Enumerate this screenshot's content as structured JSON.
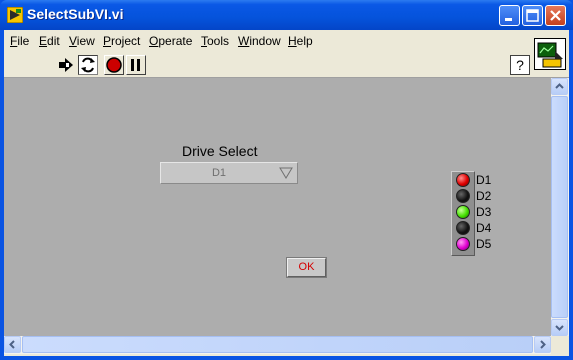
{
  "window": {
    "title": "SelectSubVI.vi",
    "controls": [
      "minimize-icon",
      "maximize-icon",
      "close-icon"
    ]
  },
  "menubar": {
    "items": [
      {
        "label": "File",
        "key": "F",
        "rest": "ile"
      },
      {
        "label": "Edit",
        "key": "E",
        "rest": "dit"
      },
      {
        "label": "View",
        "key": "V",
        "rest": "iew"
      },
      {
        "label": "Project",
        "key": "P",
        "rest": "roject"
      },
      {
        "label": "Operate",
        "key": "O",
        "rest": "perate"
      },
      {
        "label": "Tools",
        "key": "T",
        "rest": "ools"
      },
      {
        "label": "Window",
        "key": "W",
        "rest": "indow"
      },
      {
        "label": "Help",
        "key": "H",
        "rest": "elp"
      }
    ]
  },
  "toolbar": {
    "tools": [
      "run-arrow-icon",
      "run-continuously-icon",
      "abort-icon",
      "pause-icon"
    ],
    "help_label": "?"
  },
  "panel": {
    "drive_select": {
      "label": "Drive Select",
      "value": "D1"
    },
    "ok_button": {
      "label": "OK"
    },
    "leds": [
      {
        "label": "D1",
        "color": "#e00000"
      },
      {
        "label": "D2",
        "color": "#111111"
      },
      {
        "label": "D3",
        "color": "#44e000"
      },
      {
        "label": "D4",
        "color": "#111111"
      },
      {
        "label": "D5",
        "color": "#e000d0"
      }
    ]
  },
  "colors": {
    "panel_bg": "#adadad",
    "titlebar": "#0553db",
    "ok_text": "#d40000"
  }
}
